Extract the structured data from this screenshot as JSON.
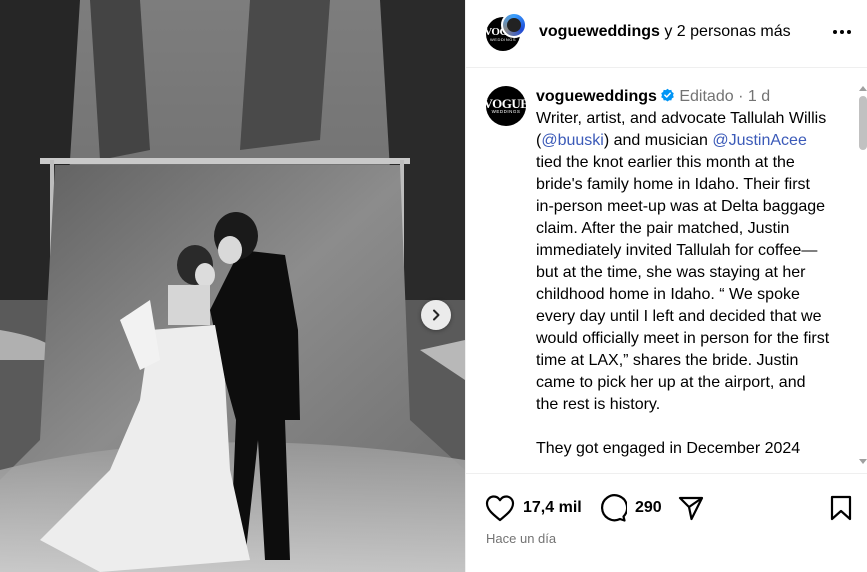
{
  "header": {
    "username": "vogueweddings",
    "others": "y 2 personas más",
    "more_icon": "more-horizontal-icon"
  },
  "avatar": {
    "logo_text": "VOGUE",
    "logo_sub": "WEDDINGS"
  },
  "caption": {
    "username": "vogueweddings",
    "edited": "Editado",
    "dot": "·",
    "age": "1 d",
    "text_1": "Writer, artist, and advocate Tallulah Willis (",
    "mention_1": "@buuski",
    "text_2": ") and musician ",
    "mention_2": "@JustinAcee",
    "text_3": " tied the knot earlier this month at the bride's family home in Idaho. Their first in-person meet-up was at Delta baggage claim. After the pair matched, Justin immediately invited Tallulah for coffee—but at the time, she was staying at her childhood home in Idaho. “ We spoke every day until I left and decided that we would officially meet in person for the first time at LAX,” shares the bride. Justin came to pick her up at the airport, and the rest is history.",
    "text_4": "They got engaged in December 2024"
  },
  "actions": {
    "likes": "17,4 mil",
    "comments": "290",
    "timestamp": "Hace un día"
  },
  "colors": {
    "mention": "#3b5ab8",
    "muted": "#737373",
    "verified": "#0095f6"
  }
}
